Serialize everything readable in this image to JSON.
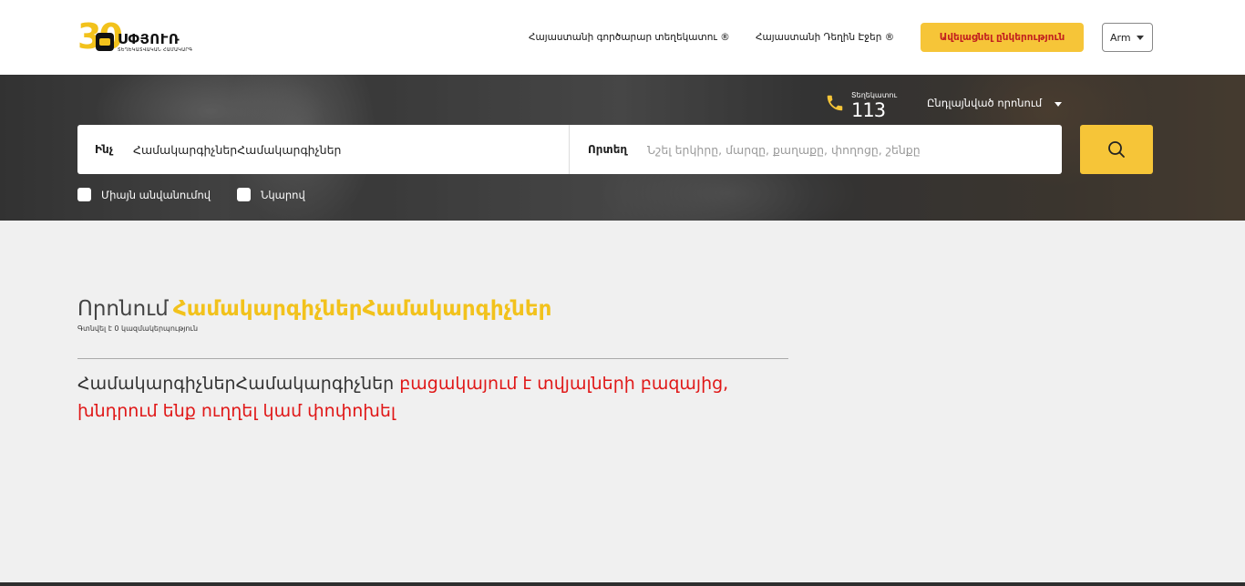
{
  "header": {
    "logo": {
      "number": "30",
      "name": "ՍՓՅՈՒՌ",
      "subtitle": "ՏԵՂԵԿԱՏՎԱԿԱՆ ՀԱՄԱԿԱՐԳ"
    },
    "nav": [
      {
        "label": "Հայաստանի գործարար տեղեկատու ®"
      },
      {
        "label": "Հայաստանի Դեղին Էջեր ®"
      }
    ],
    "cta_label": "Ավելացնել ընկերություն",
    "language": "Arm"
  },
  "hero": {
    "phone": {
      "label": "Տեղեկատու",
      "number": "113"
    },
    "advanced_search": "Ընդլայնված որոնում",
    "search": {
      "what_label": "Ինչ",
      "what_value": "ՀամակարգիչներՀամակարգիչներ",
      "where_label": "Որտեղ",
      "where_placeholder": "Նշել երկիրը, մարզը, քաղաքը, փողոցը, շենքը"
    },
    "filters": [
      {
        "label": "Միայն անվանումով",
        "checked": false
      },
      {
        "label": "Նկարով",
        "checked": false
      }
    ]
  },
  "results": {
    "prefix": "Որոնում",
    "query": "ՀամակարգիչներՀամակարգիչներ",
    "count_text": "Գտնվել է 0 կազմակերպություն",
    "message_query": "ՀամակարգիչներՀամակարգիչներ",
    "message_rest": " բացակայում է տվյալների բազայից, խնդրում ենք ուղղել կամ փոփոխել"
  },
  "colors": {
    "accent": "#f6c538",
    "query_text": "#f2c21c",
    "error": "#e01818",
    "cta_text": "#c21f1f"
  },
  "icons": [
    "logo-badge-icon",
    "phone-icon",
    "search-icon",
    "caret-down-icon"
  ]
}
